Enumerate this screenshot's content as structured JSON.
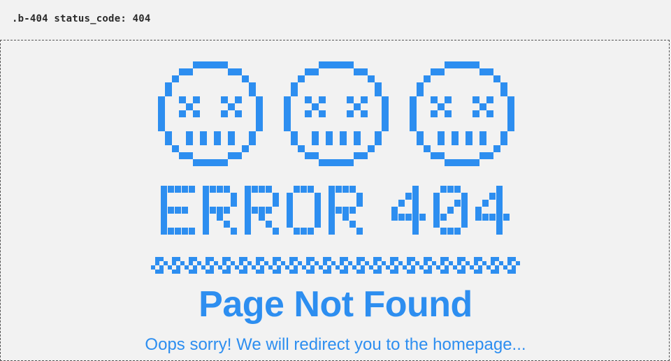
{
  "header": {
    "component_label": ".b-404 status_code: 404"
  },
  "error": {
    "heading": "ERROR 404",
    "title": "Page Not Found",
    "message": "Oops sorry! We will redirect you to the homepage..."
  },
  "icons": [
    "dead-face-icon",
    "dead-face-icon",
    "dead-face-icon"
  ],
  "colors": {
    "accent": "#2d8ef0",
    "background": "#f2f2f2",
    "label_text": "#2b2b2b",
    "frame_border": "#555555"
  }
}
